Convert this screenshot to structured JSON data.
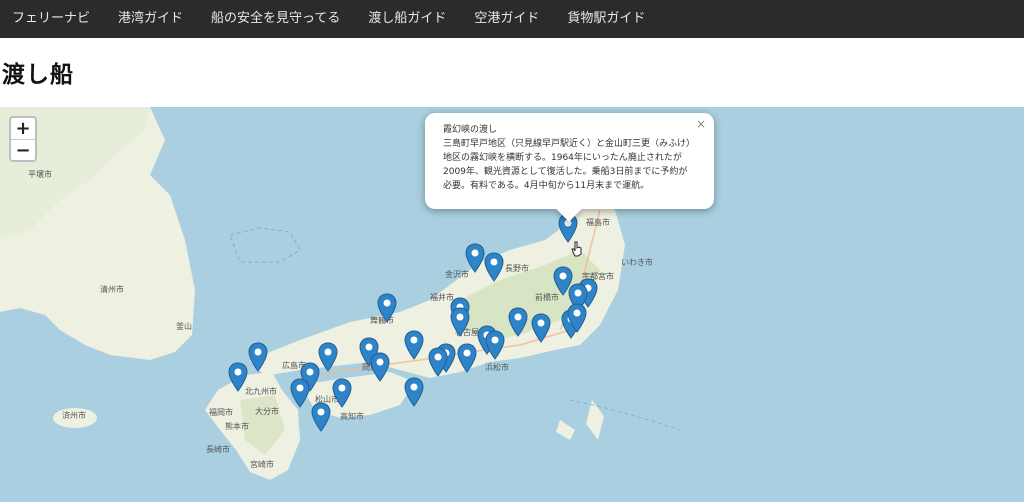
{
  "navbar": {
    "items": [
      {
        "label": "フェリーナビ"
      },
      {
        "label": "港湾ガイド"
      },
      {
        "label": "船の安全を見守ってる"
      },
      {
        "label": "渡し船ガイド"
      },
      {
        "label": "空港ガイド"
      },
      {
        "label": "貨物駅ガイド"
      }
    ]
  },
  "page": {
    "title": "渡し船"
  },
  "map": {
    "zoom_in": "+",
    "zoom_out": "−",
    "colors": {
      "sea": "#a9cfe0",
      "land": "#f0eee6",
      "marker": "#2f84c8"
    },
    "city_labels": [
      "釜山",
      "大分市",
      "熊本市",
      "長崎市",
      "福岡市",
      "宮崎市",
      "北九州市",
      "広島市",
      "岡山市",
      "高知市",
      "松山市",
      "福井市",
      "金沢市",
      "長野市",
      "前橋市",
      "宇都宮市",
      "名古屋市",
      "浜松市",
      "福島市",
      "いわき市",
      "舞鶴市",
      "清州市",
      "平壌市",
      "済州市"
    ]
  },
  "popup": {
    "title": "霞幻峡の渡し",
    "body": "三島町早戸地区（只見線早戸駅近く）と金山町三更（みふけ）地区の霧幻峡を横断する。1964年にいったん廃止されたが2009年、観光資源として復活した。乗船3日前までに予約が必要。有料である。4月中旬から11月末まで運航。",
    "close": "×"
  }
}
